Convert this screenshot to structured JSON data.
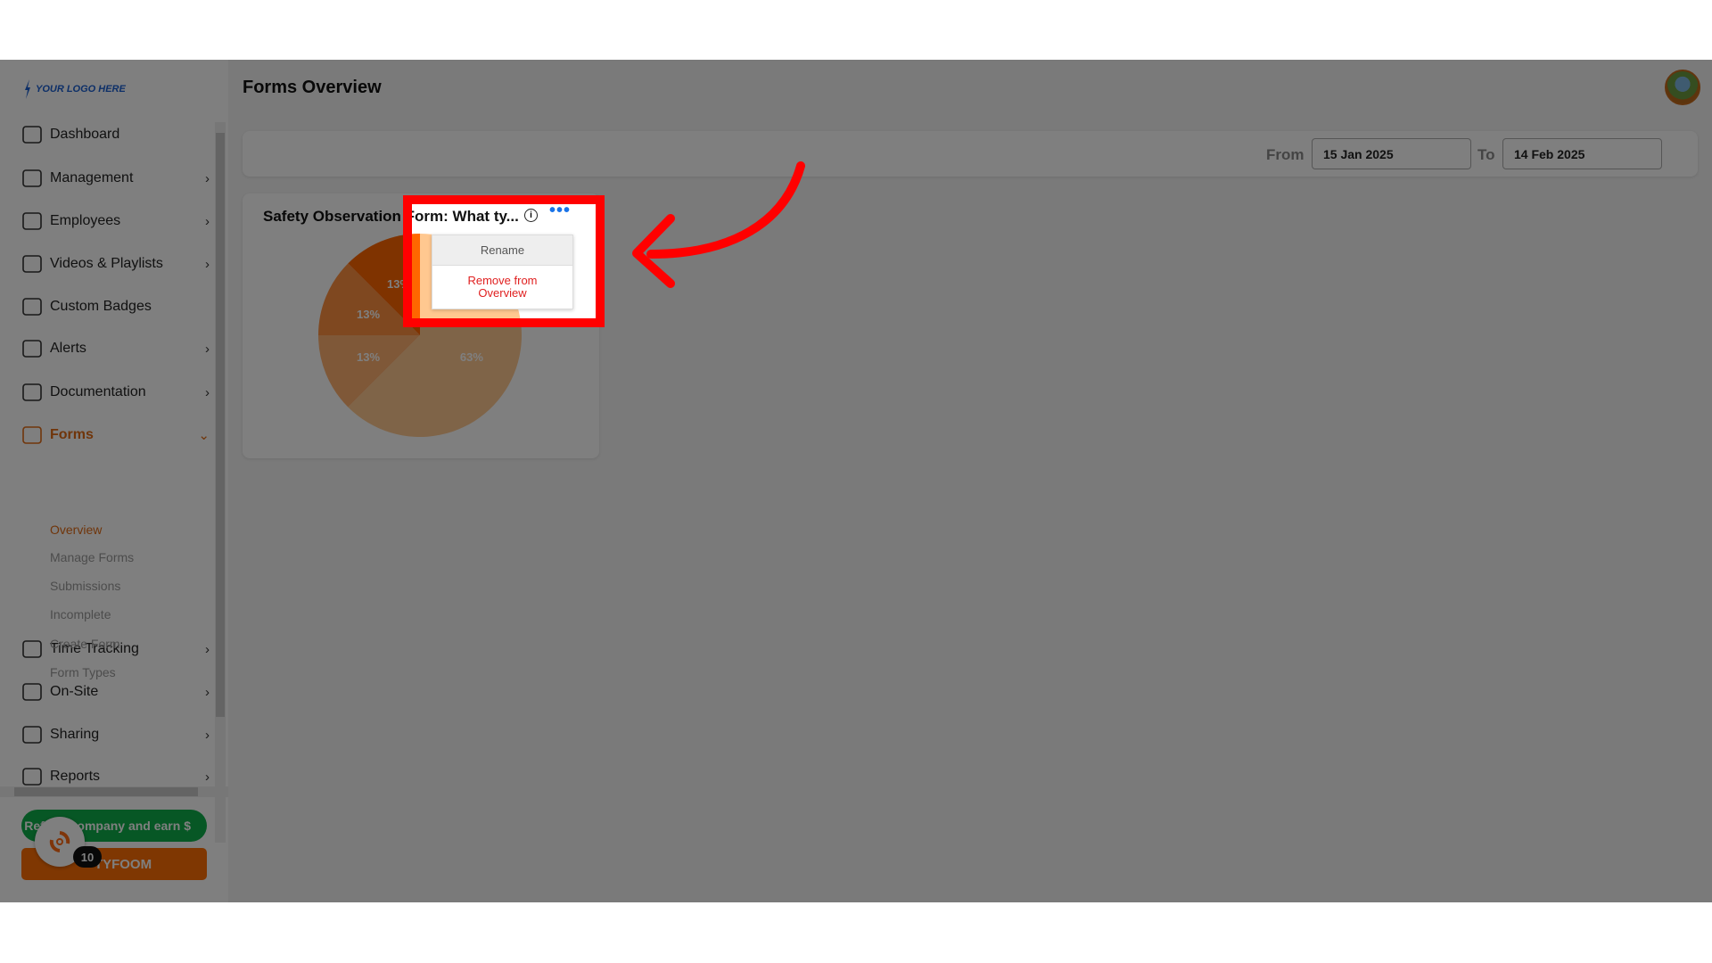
{
  "logo_text": "YOUR LOGO HERE",
  "header": {
    "title": "Forms Overview"
  },
  "sidebar": {
    "items": [
      {
        "label": "Dashboard",
        "icon": "dashboard-icon",
        "chevron": false
      },
      {
        "label": "Management",
        "icon": "management-icon",
        "chevron": true
      },
      {
        "label": "Employees",
        "icon": "employee-icon",
        "chevron": true
      },
      {
        "label": "Videos & Playlists",
        "icon": "video-icon",
        "chevron": true
      },
      {
        "label": "Custom Badges",
        "icon": "badge-icon",
        "chevron": false
      },
      {
        "label": "Alerts",
        "icon": "alert-icon",
        "chevron": true
      },
      {
        "label": "Documentation",
        "icon": "documentation-icon",
        "chevron": true
      },
      {
        "label": "Forms",
        "icon": "forms-icon",
        "chevron": true,
        "expanded": true
      },
      {
        "label": "Time Tracking",
        "icon": "stopwatch-icon",
        "chevron": true
      },
      {
        "label": "On-Site",
        "icon": "location-pin-icon",
        "chevron": true
      },
      {
        "label": "Sharing",
        "icon": "sharing-icon",
        "chevron": true
      },
      {
        "label": "Reports",
        "icon": "reports-icon",
        "chevron": true
      }
    ],
    "forms_sub": [
      "Overview",
      "Manage Forms",
      "Submissions",
      "Incomplete",
      "Create Form",
      "Form Types"
    ],
    "refer_button": "Refer a company and earn $",
    "tyfoom_button": "TYFOOM",
    "help_badge": "10"
  },
  "filter": {
    "from_label": "From",
    "from_value": "15 Jan 2025",
    "to_label": "To",
    "to_value": "14 Feb 2025"
  },
  "card": {
    "title": "Safety Observation Form: What ty...",
    "menu": {
      "rename": "Rename",
      "remove": "Remove from Overview"
    }
  },
  "chart_data": {
    "type": "pie",
    "values": [
      62.5,
      12.5,
      12.5,
      12.5
    ],
    "labels": [
      "63%",
      "13%",
      "13%",
      "13%"
    ],
    "colors": [
      "#ffc890",
      "#ffb070",
      "#ff9040",
      "#ff6600"
    ]
  },
  "colors": {
    "accent": "#e06a14",
    "highlight": "#ff0000",
    "link": "#1a73e8"
  }
}
